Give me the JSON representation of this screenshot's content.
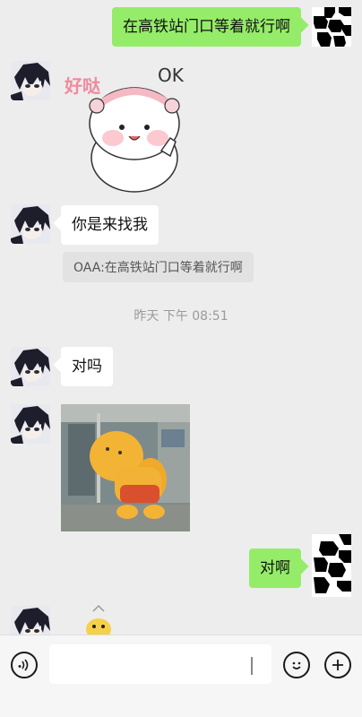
{
  "messages": {
    "sent_top": "在高铁站门口等着就行啊",
    "sticker_text_1": "好哒",
    "sticker_text_2": "OK",
    "reply_1": "你是来找我",
    "quote": "OAA:在高铁站门口等着就行啊",
    "timestamp": "昨天 下午 08:51",
    "reply_2": "对吗",
    "sent_bottom": "对啊"
  },
  "input": {
    "value": "",
    "placeholder": ""
  },
  "icons": {
    "voice": "voice-icon",
    "emoji": "emoji-icon",
    "more": "add-icon"
  },
  "colors": {
    "background": "#ededed",
    "sent_bubble": "#95ec69",
    "received_bubble": "#ffffff",
    "timestamp": "#9a9a9a"
  }
}
